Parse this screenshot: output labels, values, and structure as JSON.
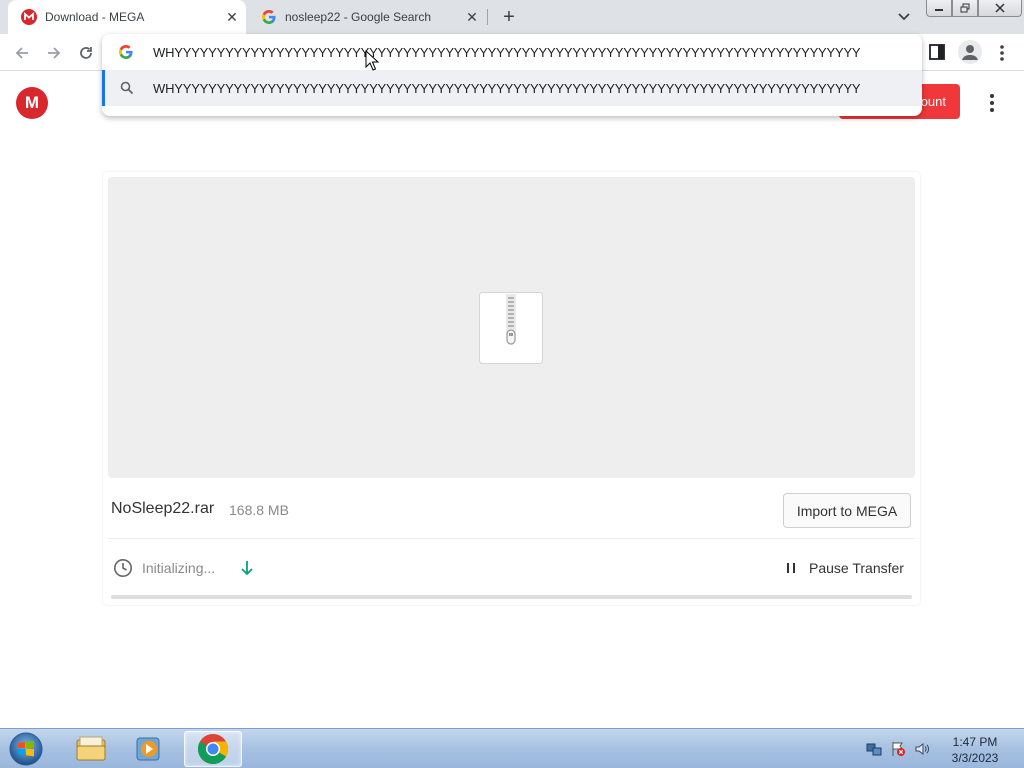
{
  "browser": {
    "tabs": [
      {
        "title": "Download - MEGA",
        "favicon": "mega-icon",
        "active": true
      },
      {
        "title": "nosleep22 - Google Search",
        "favicon": "google-icon",
        "active": false
      }
    ],
    "new_tab": "+",
    "omnibox": {
      "input_text": "WHYYYYYYYYYYYYYYYYYYYYYYYYYYYYYYYYYYYYYYYYYYYYYYYYYYYYYYYYYYYYYYYYYYYYYYYYYYYYYYYYY",
      "suggestion_text": "WHYYYYYYYYYYYYYYYYYYYYYYYYYYYYYYYYYYYYYYYYYYYYYYYYYYYYYYYYYYYYYYYYYYYYYYYYYYYYYYYYY"
    }
  },
  "mega": {
    "logo": "M",
    "account_button_visible_text": "ount",
    "file": {
      "name": "NoSleep22.rar",
      "size": "168.8 MB",
      "icon": "zip-archive-icon"
    },
    "import_button": "Import to MEGA",
    "status": "Initializing...",
    "pause_button": "Pause Transfer",
    "progress_fraction": 0.0,
    "colors": {
      "brand_red": "#d9272e",
      "progress_green": "#00a382"
    }
  },
  "taskbar": {
    "pinned": [
      "windows-explorer-icon",
      "media-player-icon",
      "chrome-icon"
    ],
    "clock_time": "1:47 PM",
    "clock_date": "3/3/2023"
  }
}
